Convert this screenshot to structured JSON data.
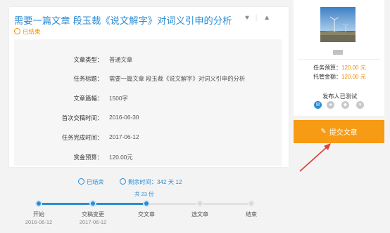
{
  "task": {
    "title": "需要一篇文章 段玉裁《说文解字》对词义引申的分析",
    "status": "已结束"
  },
  "title_icons": [
    "heart-icon",
    "bell-icon"
  ],
  "details": [
    {
      "key": "文章类型：",
      "value": "普通文章"
    },
    {
      "key": "任务标题：",
      "value": "需要一篇文章 段玉裁《说文解字》对词义引申的分析"
    },
    {
      "key": "文章篇幅：",
      "value": "1500字"
    },
    {
      "key": "首次交稿时间：",
      "value": "2016-06-30"
    },
    {
      "key": "任务完成时间：",
      "value": "2017-06-12"
    },
    {
      "key": "赏金预算：",
      "value": "120.00元"
    }
  ],
  "progress": {
    "ended_label": "已结束",
    "remaining_label": "剩余时间：342 天 12",
    "count": "共 23 份",
    "fill_fraction": 0.5,
    "steps": [
      {
        "label": "开始",
        "date": "2016-06-12",
        "state": "done"
      },
      {
        "label": "交稿变更",
        "date": "2017-06-12",
        "state": "done"
      },
      {
        "label": "交文章",
        "date": "",
        "state": "done"
      },
      {
        "label": "选文章",
        "date": "",
        "state": "todo"
      },
      {
        "label": "结束",
        "date": "",
        "state": "todo"
      }
    ]
  },
  "sidebar": {
    "budget_label": "任务预算：",
    "budget_value": "120.00 元",
    "bounty_label": "托管金额：",
    "bounty_value": "120.00 元",
    "publisher_title": "发布人已测试",
    "contact_icons": [
      "email-icon",
      "wechat-icon",
      "qq-icon",
      "more-icon"
    ]
  },
  "submit_button": {
    "label": "提交文章",
    "icon": "edit-icon"
  },
  "colors": {
    "link_blue": "#2a8cd4",
    "accent_orange": "#f79a14",
    "status_orange": "#f08c00",
    "annotation_red": "#d9453b"
  }
}
